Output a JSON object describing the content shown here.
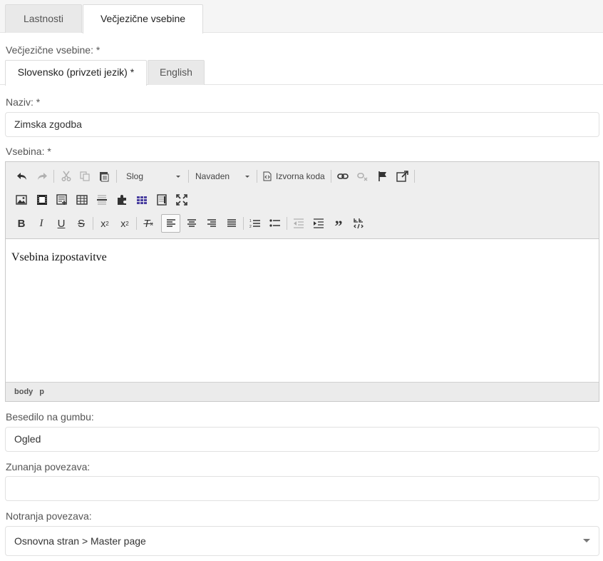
{
  "tabs": [
    {
      "label": "Lastnosti",
      "active": false
    },
    {
      "label": "Večjezične vsebine",
      "active": true
    }
  ],
  "multilang": {
    "label": "Večjezične vsebine: *",
    "languages": [
      {
        "label": "Slovensko (privzeti jezik) *",
        "active": true
      },
      {
        "label": "English",
        "active": false
      }
    ]
  },
  "name": {
    "label": "Naziv: *",
    "value": "Zimska zgodba"
  },
  "content": {
    "label": "Vsebina: *",
    "toolbar": {
      "style_combo": "Slog",
      "format_combo": "Navaden",
      "source_label": "Izvorna koda",
      "icons": [
        "undo-icon",
        "redo-icon",
        "cut-icon",
        "copy-icon",
        "paste-icon",
        "image-icon",
        "video-icon",
        "templates-icon",
        "table-icon",
        "horizontal-rule-icon",
        "plugin-icon",
        "grid-icon",
        "iframe-icon",
        "maximize-icon",
        "bold-icon",
        "italic-icon",
        "underline-icon",
        "strikethrough-icon",
        "subscript-icon",
        "superscript-icon",
        "remove-format-icon",
        "align-left-icon",
        "align-center-icon",
        "align-right-icon",
        "align-justify-icon",
        "numbered-list-icon",
        "bulleted-list-icon",
        "outdent-icon",
        "indent-icon",
        "blockquote-icon",
        "show-blocks-icon",
        "link-icon",
        "unlink-icon",
        "anchor-icon",
        "open-link-icon"
      ]
    },
    "body_text": "Vsebina izpostavitve",
    "path": [
      "body",
      "p"
    ]
  },
  "button_text": {
    "label": "Besedilo na gumbu:",
    "value": "Ogled"
  },
  "external_link": {
    "label": "Zunanja povezava:",
    "value": ""
  },
  "internal_link": {
    "label": "Notranja povezava:",
    "value": "Osnovna stran > Master page"
  },
  "colors": {
    "accent_tab": "#ffffff",
    "inactive_tab": "#e9e9e9",
    "toolbar": "#eeeeee",
    "border": "#e1e1e1"
  }
}
